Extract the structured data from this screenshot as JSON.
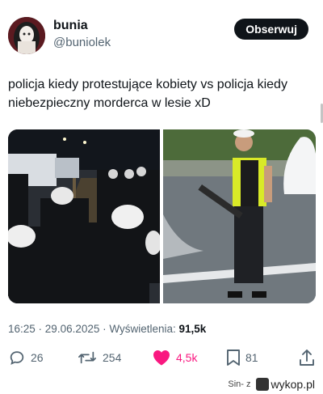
{
  "post": {
    "author": {
      "name": "bunia",
      "handle": "@buniolek"
    },
    "follow_label": "Obserwuj",
    "text": "policja kiedy protestujące kobiety vs policja kiedy niebezpieczny morderca w lesie xD",
    "meta": {
      "time": "16:25",
      "separator": " · ",
      "date": "29.06.2025",
      "views_label": "Wyświetlenia: ",
      "views": "91,5k"
    },
    "stats": {
      "replies": "26",
      "reposts": "254",
      "likes": "4,5k",
      "bookmarks": "81"
    },
    "media": [
      "riot-police-photo",
      "armed-officer-photo"
    ]
  },
  "watermark": {
    "user": "Sin- z",
    "site": "wykop.pl"
  },
  "colors": {
    "text": "#0f1419",
    "secondary": "#536471",
    "like": "#f91880",
    "button": "#0f1419"
  },
  "icons": [
    "reply-icon",
    "repost-icon",
    "like-icon",
    "bookmark-icon",
    "share-icon"
  ]
}
